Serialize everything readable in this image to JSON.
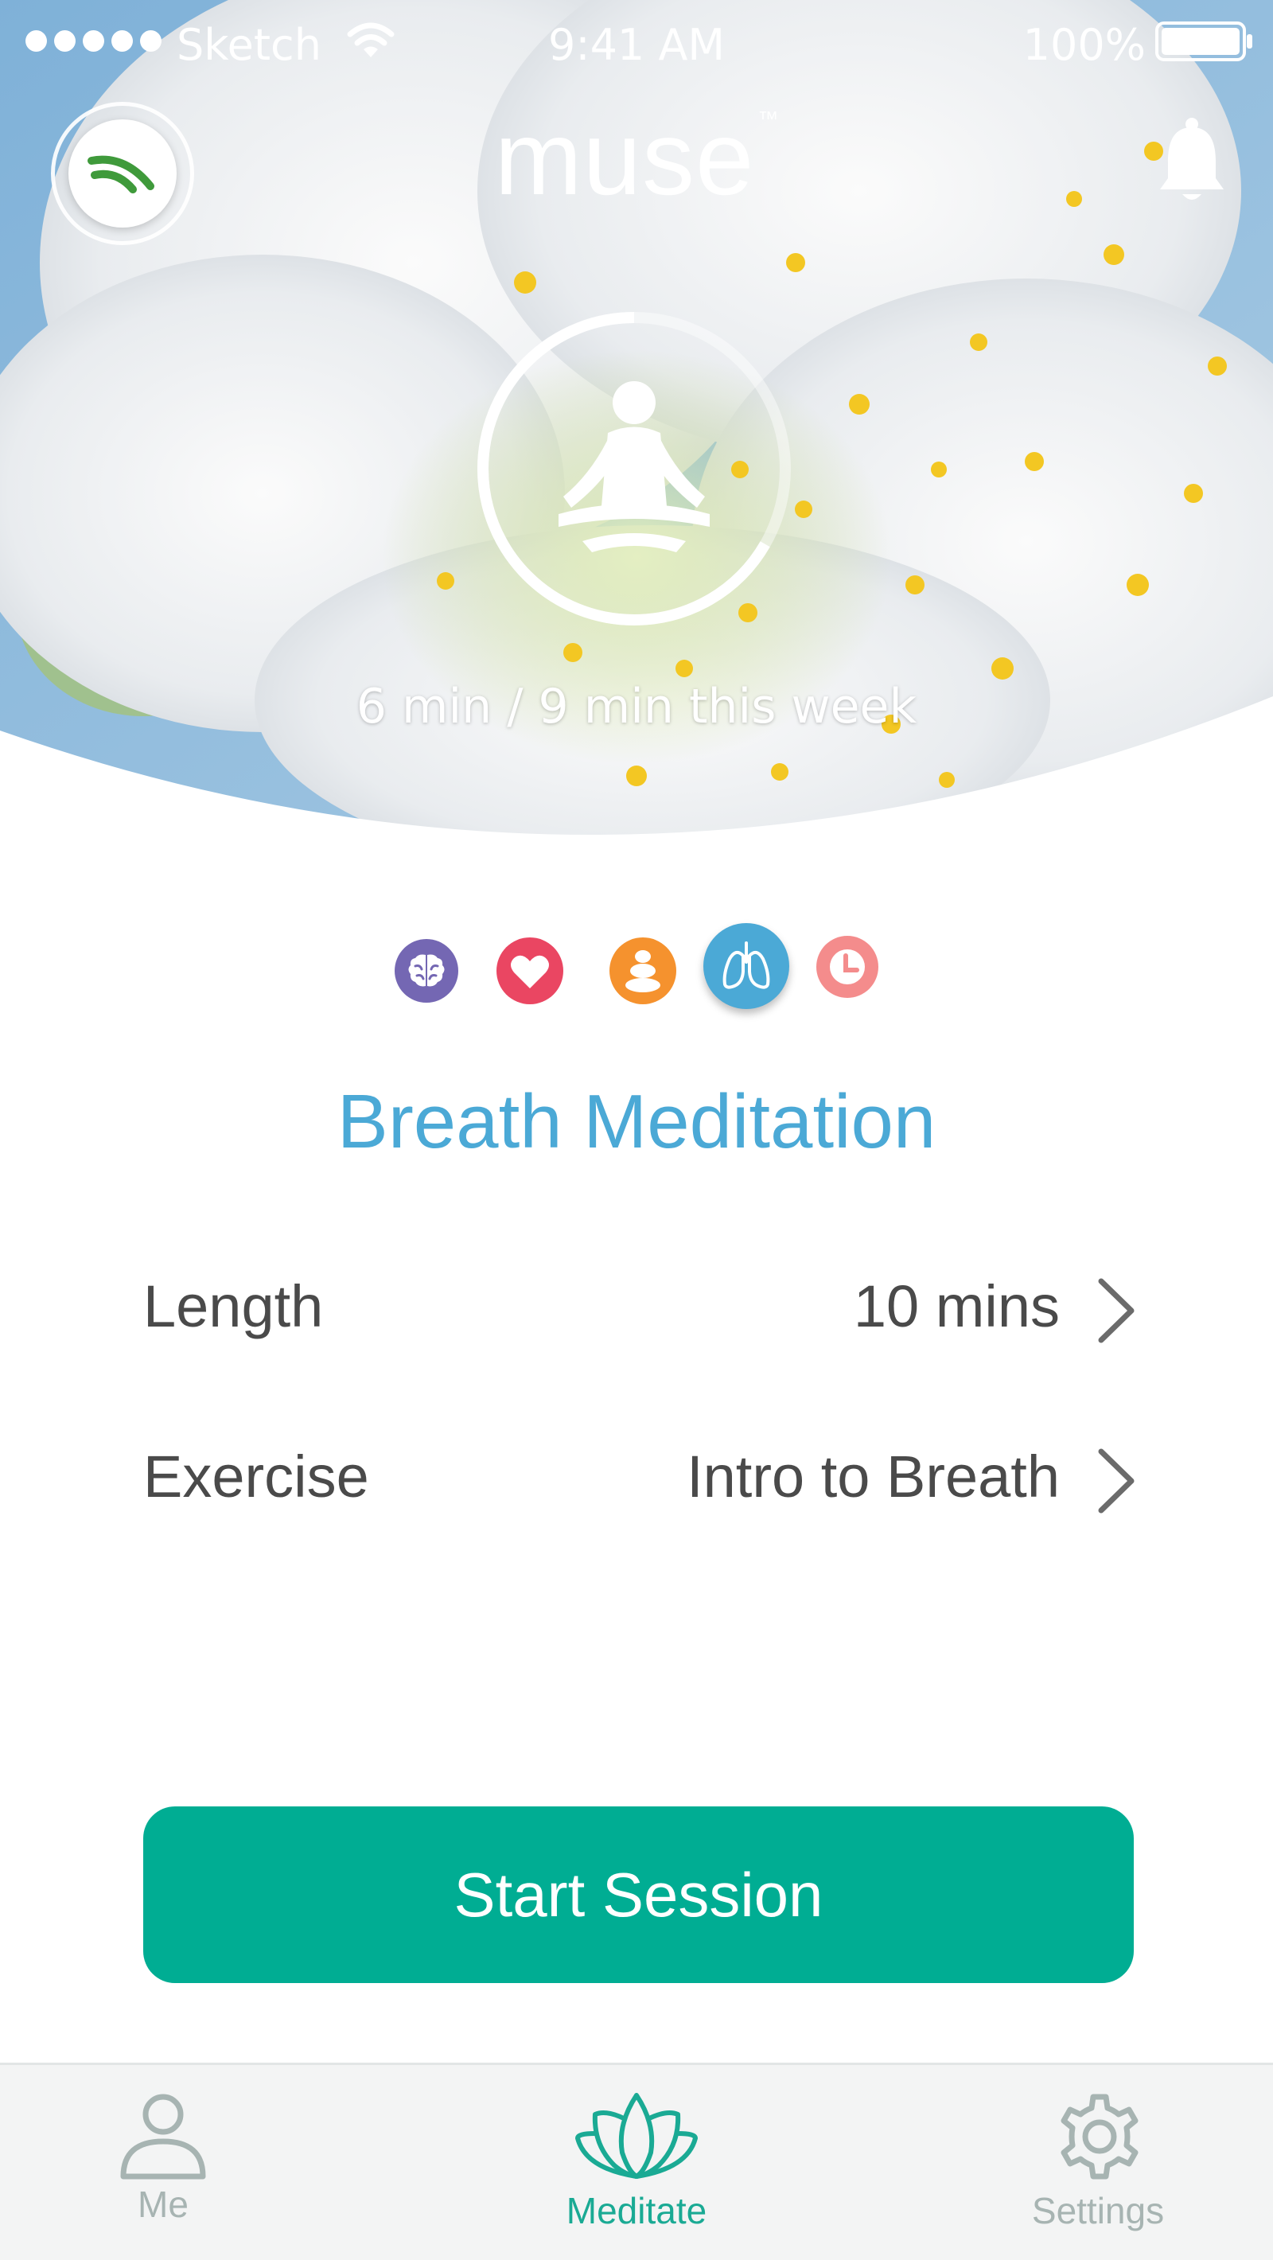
{
  "status_bar": {
    "carrier": "Sketch",
    "time": "9:41 AM",
    "battery": "100%"
  },
  "header": {
    "logo": "muse",
    "logo_tm": "™",
    "weekly_progress": "6 min / 9 min this week",
    "weekly_progress_fraction": 0.667
  },
  "categories": [
    {
      "name": "brain",
      "icon": "brain-icon",
      "color": "#7467b3",
      "selected": false
    },
    {
      "name": "heart",
      "icon": "heart-icon",
      "color": "#ea4662",
      "selected": false
    },
    {
      "name": "body",
      "icon": "stones-icon",
      "color": "#f5922e",
      "selected": false
    },
    {
      "name": "breath",
      "icon": "lungs-icon",
      "color": "#4ba9d6",
      "selected": true
    },
    {
      "name": "timer",
      "icon": "clock-icon",
      "color": "#f48c8c",
      "selected": false
    }
  ],
  "session": {
    "title": "Breath Meditation",
    "length_label": "Length",
    "length_value": "10 mins",
    "exercise_label": "Exercise",
    "exercise_value": "Intro to Breath",
    "start_label": "Start Session"
  },
  "tabs": [
    {
      "label": "Me",
      "icon": "person-icon",
      "active": false
    },
    {
      "label": "Meditate",
      "icon": "lotus-icon",
      "active": true
    },
    {
      "label": "Settings",
      "icon": "gear-icon",
      "active": false
    }
  ],
  "colors": {
    "accent": "#00ad93",
    "title": "#4ba9d6",
    "text": "#4a4a4a",
    "tab_inactive": "#a7b4b2"
  }
}
